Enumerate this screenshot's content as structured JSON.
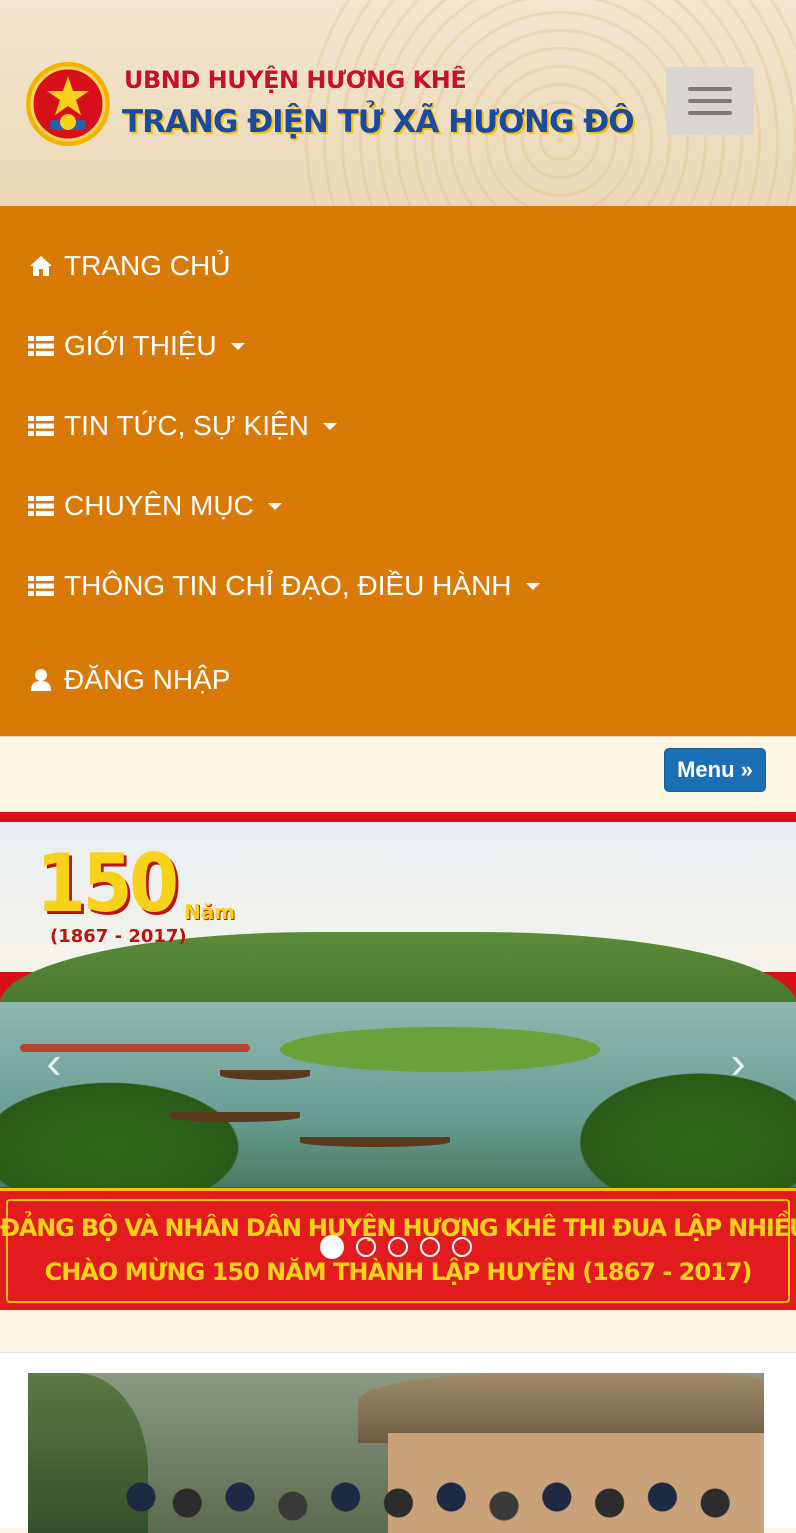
{
  "header": {
    "line1": "UBND HUYỆN HƯƠNG KHÊ",
    "line2": "TRANG ĐIỆN TỬ XÃ HƯƠNG ĐÔ",
    "menu_toggle_icon": "hamburger-icon"
  },
  "nav": {
    "items": [
      {
        "label": "TRANG CHỦ",
        "icon": "home-icon",
        "has_dropdown": false
      },
      {
        "label": "GIỚI THIỆU",
        "icon": "list-icon",
        "has_dropdown": true
      },
      {
        "label": "TIN TỨC, SỰ KIỆN",
        "icon": "list-icon",
        "has_dropdown": true
      },
      {
        "label": "CHUYÊN MỤC",
        "icon": "list-icon",
        "has_dropdown": true
      },
      {
        "label": "THÔNG TIN CHỈ ĐẠO, ĐIỀU HÀNH",
        "icon": "list-icon",
        "has_dropdown": true
      },
      {
        "label": "ĐĂNG NHẬP",
        "icon": "user-icon",
        "has_dropdown": false
      }
    ]
  },
  "menu_button": {
    "label": "Menu »"
  },
  "banner": {
    "big_number": "150",
    "nam": "Năm",
    "years": "(1867 - 2017)",
    "slogan_line1": "ĐẢNG BỘ VÀ NHÂN DÂN HUYỆN HƯƠNG KHÊ THI ĐUA LẬP NHIỀU THÀNH TÍCH",
    "slogan_line2": "CHÀO MỪNG 150 NĂM THÀNH LẬP HUYỆN (1867 - 2017)",
    "prev_icon": "chevron-left-icon",
    "next_icon": "chevron-right-icon",
    "slide_count": 5,
    "active_slide": 1
  },
  "colors": {
    "nav_bg": "#d97a06",
    "menu_button_bg": "#1a6fb5",
    "page_bg": "#fdf6e3",
    "title_red": "#c8102e",
    "title_blue": "#1b4aa0"
  }
}
